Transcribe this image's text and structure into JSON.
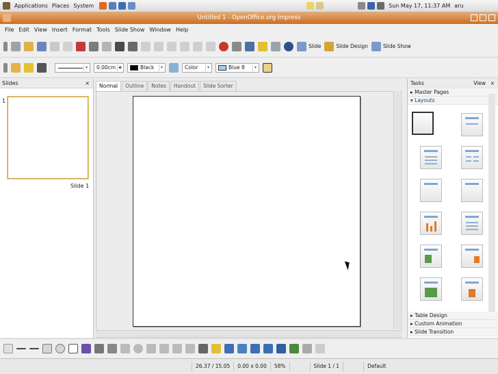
{
  "panel": {
    "apps": "Applications",
    "places": "Places",
    "system": "System",
    "clock": "Sun May 17, 11:37 AM",
    "user": "aru"
  },
  "window": {
    "title": "Untitled 1 - OpenOffice.org Impress"
  },
  "menu": [
    "File",
    "Edit",
    "View",
    "Insert",
    "Format",
    "Tools",
    "Slide Show",
    "Window",
    "Help"
  ],
  "toolbar": {
    "slide_label": "Slide",
    "slide_design_label": "Slide Design",
    "slide_show_label": "Slide Show"
  },
  "format_bar": {
    "line_width": "0.00cm",
    "line_color": "Black",
    "area_style": "Color",
    "area_color": "Blue 8",
    "colors": {
      "black": "#000000",
      "blue8": "#99ccff"
    }
  },
  "slides_panel": {
    "title": "Slides",
    "close": "×",
    "slide_number": "1",
    "slide_caption": "Slide 1"
  },
  "view_tabs": [
    "Normal",
    "Outline",
    "Notes",
    "Handout",
    "Slide Sorter"
  ],
  "tasks": {
    "title": "Tasks",
    "view": "View",
    "close": "×",
    "master_pages": "Master Pages",
    "layouts": "Layouts",
    "table_design": "Table Design",
    "custom_animation": "Custom Animation",
    "slide_transition": "Slide Transition"
  },
  "status": {
    "position": "26.37 / 15.05",
    "size": "0.00 x 0.00",
    "zoom": "58%",
    "slide": "Slide 1 / 1",
    "layout": "Default"
  },
  "colors": {
    "titlebar": "#d9823a",
    "accent": "#c8a14a"
  }
}
